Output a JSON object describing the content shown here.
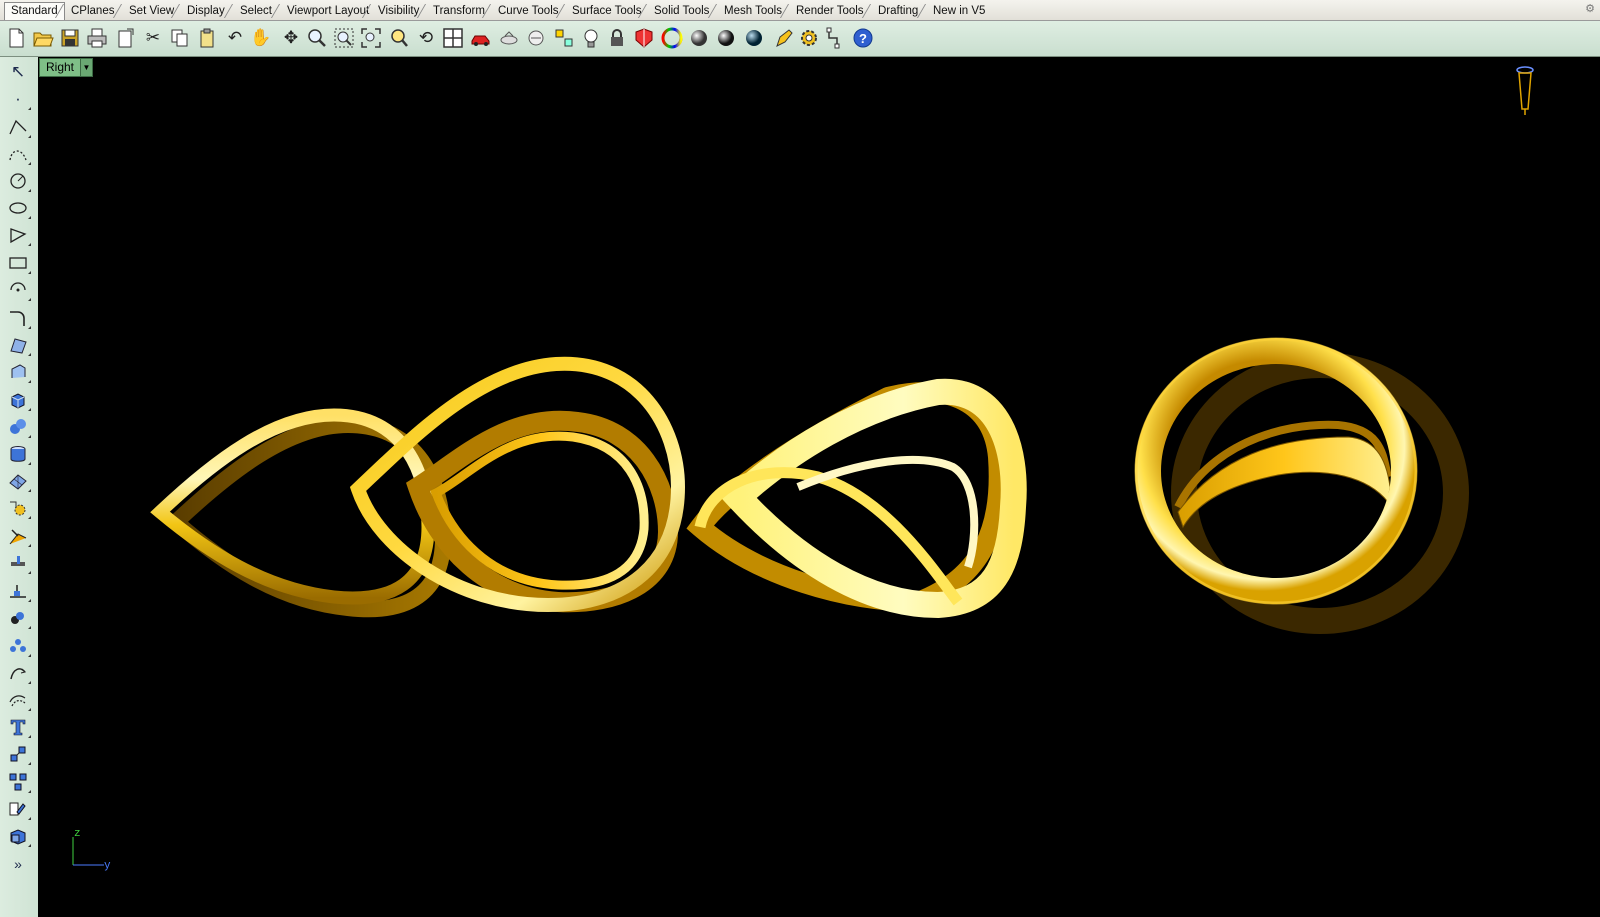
{
  "tabs": [
    {
      "label": "Standard",
      "active": true
    },
    {
      "label": "CPlanes"
    },
    {
      "label": "Set View"
    },
    {
      "label": "Display"
    },
    {
      "label": "Select"
    },
    {
      "label": "Viewport Layout"
    },
    {
      "label": "Visibility"
    },
    {
      "label": "Transform"
    },
    {
      "label": "Curve Tools"
    },
    {
      "label": "Surface Tools"
    },
    {
      "label": "Solid Tools"
    },
    {
      "label": "Mesh Tools"
    },
    {
      "label": "Render Tools"
    },
    {
      "label": "Drafting"
    },
    {
      "label": "New in V5"
    }
  ],
  "toolbar_icons": [
    "new-file-icon",
    "open-folder-icon",
    "save-icon",
    "print-icon",
    "import-icon",
    "cut-icon",
    "copy-icon",
    "paste-icon",
    "undo-icon",
    "pan-hand-icon",
    "move-viewport-icon",
    "zoom-dynamic-icon",
    "zoom-window-icon",
    "zoom-extents-icon",
    "zoom-selected-icon",
    "rotate-view-icon",
    "four-viewports-icon",
    "car-display-icon",
    "named-views-icon",
    "cplane-icon",
    "snap-points-icon",
    "light-bulb-icon",
    "lock-icon",
    "material-icon",
    "color-wheel-icon",
    "shaded-sphere-icon",
    "rendered-sphere-icon",
    "blue-sphere-icon",
    "pencil-properties-icon",
    "options-gear-icon",
    "dimension-icon",
    "help-icon"
  ],
  "left_tools": [
    "select-arrow-icon",
    "point-icon",
    "polyline-icon",
    "curve-control-points-icon",
    "circle-icon",
    "ellipse-icon",
    "polygon-icon",
    "rectangle-icon",
    "arc-icon",
    "fillet-curve-icon",
    "surface-corner-icon",
    "extrude-surface-icon",
    "box-solid-icon",
    "sphere-solid-icon",
    "cylinder-solid-icon",
    "mesh-plane-icon",
    "transform-gear-icon",
    "boolean-union-icon",
    "analyze-icon",
    "dimension-tool-icon",
    "group-icon",
    "points-cloud-icon",
    "curve-from-object-icon",
    "offset-curve-icon",
    "text-icon",
    "array-icon",
    "block-icon",
    "layer-tool-icon",
    "solid-box-icon",
    "more-tools-icon"
  ],
  "viewport": {
    "name": "Right",
    "background": "#000000",
    "axis_vertical": "z",
    "axis_horizontal": "y"
  },
  "colors": {
    "gold_light": "#fff6a8",
    "gold_mid": "#f2c514",
    "gold_dark": "#8a6200",
    "axis_green": "#3fd13f",
    "axis_blue": "#4b7cff"
  }
}
